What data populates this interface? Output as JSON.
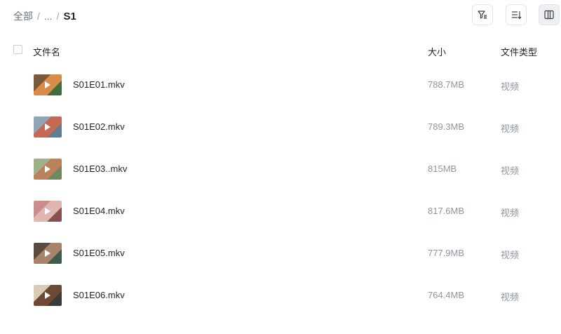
{
  "breadcrumb": {
    "root": "全部",
    "separator": "/",
    "ellipsis": "...",
    "current": "S1"
  },
  "toolbar": {
    "filter_icon": "filter-icon",
    "sort_icon": "sort-icon",
    "layout_icon": "columns-icon"
  },
  "header": {
    "name": "文件名",
    "size": "大小",
    "type": "文件类型"
  },
  "files": [
    {
      "name": "S01E01.mkv",
      "size": "788.7MB",
      "type": "视频",
      "thumb_colors": [
        "#7a5a3c",
        "#d98b4a",
        "#3f6e3a"
      ]
    },
    {
      "name": "S01E02.mkv",
      "size": "789.3MB",
      "type": "视频",
      "thumb_colors": [
        "#8fa6b8",
        "#c46a52",
        "#5e7d93"
      ]
    },
    {
      "name": "S01E03..mkv",
      "size": "815MB",
      "type": "视频",
      "thumb_colors": [
        "#9fb08a",
        "#b9825a",
        "#6e8a5f"
      ]
    },
    {
      "name": "S01E04.mkv",
      "size": "817.6MB",
      "type": "视频",
      "thumb_colors": [
        "#c98f8f",
        "#e0b7b0",
        "#8a4f4f"
      ]
    },
    {
      "name": "S01E05.mkv",
      "size": "777.9MB",
      "type": "视频",
      "thumb_colors": [
        "#5a4a40",
        "#a8856a",
        "#3d5c4a"
      ]
    },
    {
      "name": "S01E06.mkv",
      "size": "764.4MB",
      "type": "视频",
      "thumb_colors": [
        "#d8cbb5",
        "#6e4a36",
        "#3b3b3b"
      ]
    }
  ]
}
